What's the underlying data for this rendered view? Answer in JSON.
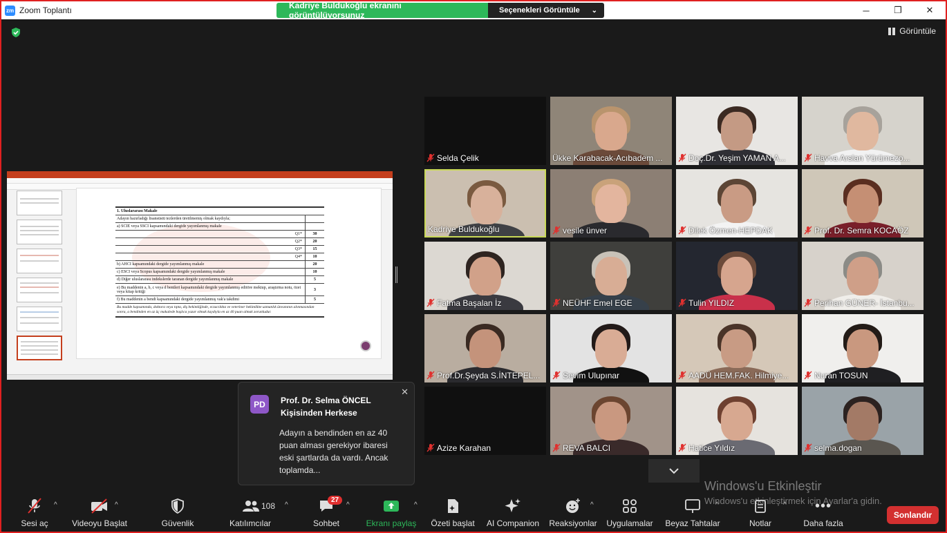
{
  "window": {
    "title": "Zoom Toplantı",
    "minimize": "─",
    "maximize": "❐",
    "close": "✕"
  },
  "share_banner": {
    "text": "Kadriye Buldukoğlu ekranını görüntülüyorsunuz",
    "options": "Seçenekleri Görüntüle"
  },
  "view_button": "Görüntüle",
  "slide": {
    "heading": "1. Uluslararası Makale",
    "rows": [
      {
        "label": "Adayın hazırladığı lisansüstü tezlerden üretilmemiş olmak kaydıyla;",
        "score": "",
        "type": "text"
      },
      {
        "label": "a) SCIE veya SSCI kapsamındaki dergide yayımlanmış makale",
        "score": "",
        "type": "text"
      },
      {
        "label": "Q1*",
        "score": "30",
        "type": "right"
      },
      {
        "label": "Q2*",
        "score": "20",
        "type": "right"
      },
      {
        "label": "Q3*",
        "score": "15",
        "type": "right"
      },
      {
        "label": "Q4*",
        "score": "10",
        "type": "right"
      },
      {
        "label": "b) AHCI kapsamındaki dergide yayımlanmış makale",
        "score": "20",
        "type": "text"
      },
      {
        "label": "c) ESCI veya Scopus kapsamındaki dergide yayımlanmış makale",
        "score": "10",
        "type": "text"
      },
      {
        "label": "d) Diğer uluslararası indekslerde taranan dergide yayımlanmış makale",
        "score": "5",
        "type": "text"
      },
      {
        "label": "e) Bu maddenin a, b, c veya d bentleri kapsamındaki dergide yayımlanmış editöre mektup, araştırma notu, özet veya kitap kritiği",
        "score": "3",
        "type": "tall"
      },
      {
        "label": "f) Bu maddenin a bendi kapsamındaki dergide yayımlanmış vak'a takdimi",
        "score": "5",
        "type": "text"
      }
    ],
    "note": "Bu madde kapsamında, doktora veya tıpta, diş hekimliğinde, eczacılıkta ve veteriner hekimlikte uzmanlık ünvanının alınmasından sonra, a bendinden en az üç makalede başlıca yazar olmak kaydıyla en az 40 puan almak zorunludur."
  },
  "participants": [
    {
      "name": "Selda Çelik",
      "muted": true,
      "bg": "#101010",
      "video": false
    },
    {
      "name": "Ükke Karabacak-Acıbadem ...",
      "muted": false,
      "bg": "#8f8578",
      "skin": "#d9a88d",
      "hair": "#b9946d",
      "cloth": "#6b4a3a",
      "video": true
    },
    {
      "name": "Doç.Dr. Yeşim YAMAN A...",
      "muted": true,
      "bg": "#e8e6e3",
      "skin": "#c49a84",
      "hair": "#3b2a22",
      "cloth": "#2f2f35",
      "video": true
    },
    {
      "name": "Havva Arslan Yürümezo...",
      "muted": true,
      "bg": "#d6d3cc",
      "skin": "#e0b89f",
      "hair": "#a7a29b",
      "cloth": "#f2f2f2",
      "video": true
    },
    {
      "name": "Kadriye Buldukoğlu",
      "muted": false,
      "active": true,
      "bg": "#cbbfb0",
      "skin": "#d8b19b",
      "hair": "#7a5a40",
      "cloth": "#3f4145",
      "video": true
    },
    {
      "name": "vesile ünver",
      "muted": true,
      "bg": "#8c7f74",
      "skin": "#e3b59e",
      "hair": "#c9a27a",
      "cloth": "#2a2a2e",
      "video": true
    },
    {
      "name": "Dilek Özmen-HEPDAK",
      "muted": true,
      "bg": "#e6e4e0",
      "skin": "#c99b84",
      "hair": "#5c4535",
      "cloth": "#f3f3f3",
      "video": true
    },
    {
      "name": "Prof. Dr. Semra KOCAÖZ",
      "muted": true,
      "bg": "#cfc7b8",
      "skin": "#c58f74",
      "hair": "#5a2e20",
      "cloth": "#7a1f2a",
      "video": true
    },
    {
      "name": "Fatma Başalan İz",
      "muted": true,
      "bg": "#dcd8d2",
      "skin": "#d1a189",
      "hair": "#2e2420",
      "cloth": "#3a3a40",
      "video": true
    },
    {
      "name": "NEÜHF Emel EGE",
      "muted": true,
      "bg": "#3f3f3c",
      "skin": "#d8ad95",
      "hair": "#c8c2b8",
      "cloth": "#36404a",
      "video": true
    },
    {
      "name": "Tulin YILDIZ",
      "muted": true,
      "bg": "#242730",
      "skin": "#d6a58e",
      "hair": "#6b4a3a",
      "cloth": "#c9304a",
      "video": true
    },
    {
      "name": "Perihan GÜNER- İstanbu...",
      "muted": true,
      "bg": "#d7d2cb",
      "skin": "#cf9f88",
      "hair": "#8b8b86",
      "cloth": "#f0eeea",
      "video": true
    },
    {
      "name": "Prof.Dr.Şeyda S.İNTEPEL...",
      "muted": true,
      "bg": "#b9ada0",
      "skin": "#c4937b",
      "hair": "#3a2a22",
      "cloth": "#2a2a2e",
      "video": true
    },
    {
      "name": "Sevim Ulupınar",
      "muted": true,
      "bg": "#e3e3e3",
      "skin": "#d9ac95",
      "hair": "#221a18",
      "cloth": "#111111",
      "video": true
    },
    {
      "name": "AADÜ HEM.FAK. Hilmiye...",
      "muted": true,
      "bg": "#d5c8b8",
      "skin": "#c89b84",
      "hair": "#4a3428",
      "cloth": "#8a6a58",
      "video": true
    },
    {
      "name": "Nuran TOSUN",
      "muted": true,
      "bg": "#f0efed",
      "skin": "#c9987f",
      "hair": "#231b17",
      "cloth": "#1f1f22",
      "video": true
    },
    {
      "name": "Azize Karahan",
      "muted": true,
      "bg": "#101010",
      "video": false
    },
    {
      "name": "REVA BALCI",
      "muted": true,
      "bg": "#a19389",
      "skin": "#c99880",
      "hair": "#6b4530",
      "cloth": "#3a2a2a",
      "video": true
    },
    {
      "name": "Hatice Yıldız",
      "muted": true,
      "bg": "#e6e3de",
      "skin": "#d7a890",
      "hair": "#6e4030",
      "cloth": "#6a6a72",
      "video": true
    },
    {
      "name": "selma.dogan",
      "muted": true,
      "bg": "#9aa3a8",
      "skin": "#a37a66",
      "hair": "#2c2220",
      "cloth": "#5a5650",
      "video": true
    }
  ],
  "chat": {
    "initials": "PD",
    "sender": "Prof. Dr. Selma ÖNCEL Kişisinden Herkese",
    "message": "Adayın a bendinden en az 40 puan alması gerekiyor ibaresi eski şartlarda da vardı. Ancak toplamda..."
  },
  "watermark": {
    "line1": "Windows'u Etkinleştir",
    "line2": "Windows'u etkinleştirmek için Ayarlar'a gidin."
  },
  "toolbar": {
    "audio": "Sesi aç",
    "video": "Videoyu Başlat",
    "security": "Güvenlik",
    "participants": "Katılımcılar",
    "participants_count": "108",
    "chat": "Sohbet",
    "chat_badge": "27",
    "share": "Ekranı paylaş",
    "summary": "Özeti başlat",
    "ai": "AI Companion",
    "reactions": "Reaksiyonlar",
    "apps": "Uygulamalar",
    "whiteboard": "Beyaz Tahtalar",
    "notes": "Notlar",
    "more": "Daha fazla",
    "end": "Sonlandır"
  },
  "colors": {
    "accent_green": "#2db85a",
    "end_red": "#d33030",
    "active_speaker": "#c9d957",
    "muted_mic": "#e0312f"
  }
}
